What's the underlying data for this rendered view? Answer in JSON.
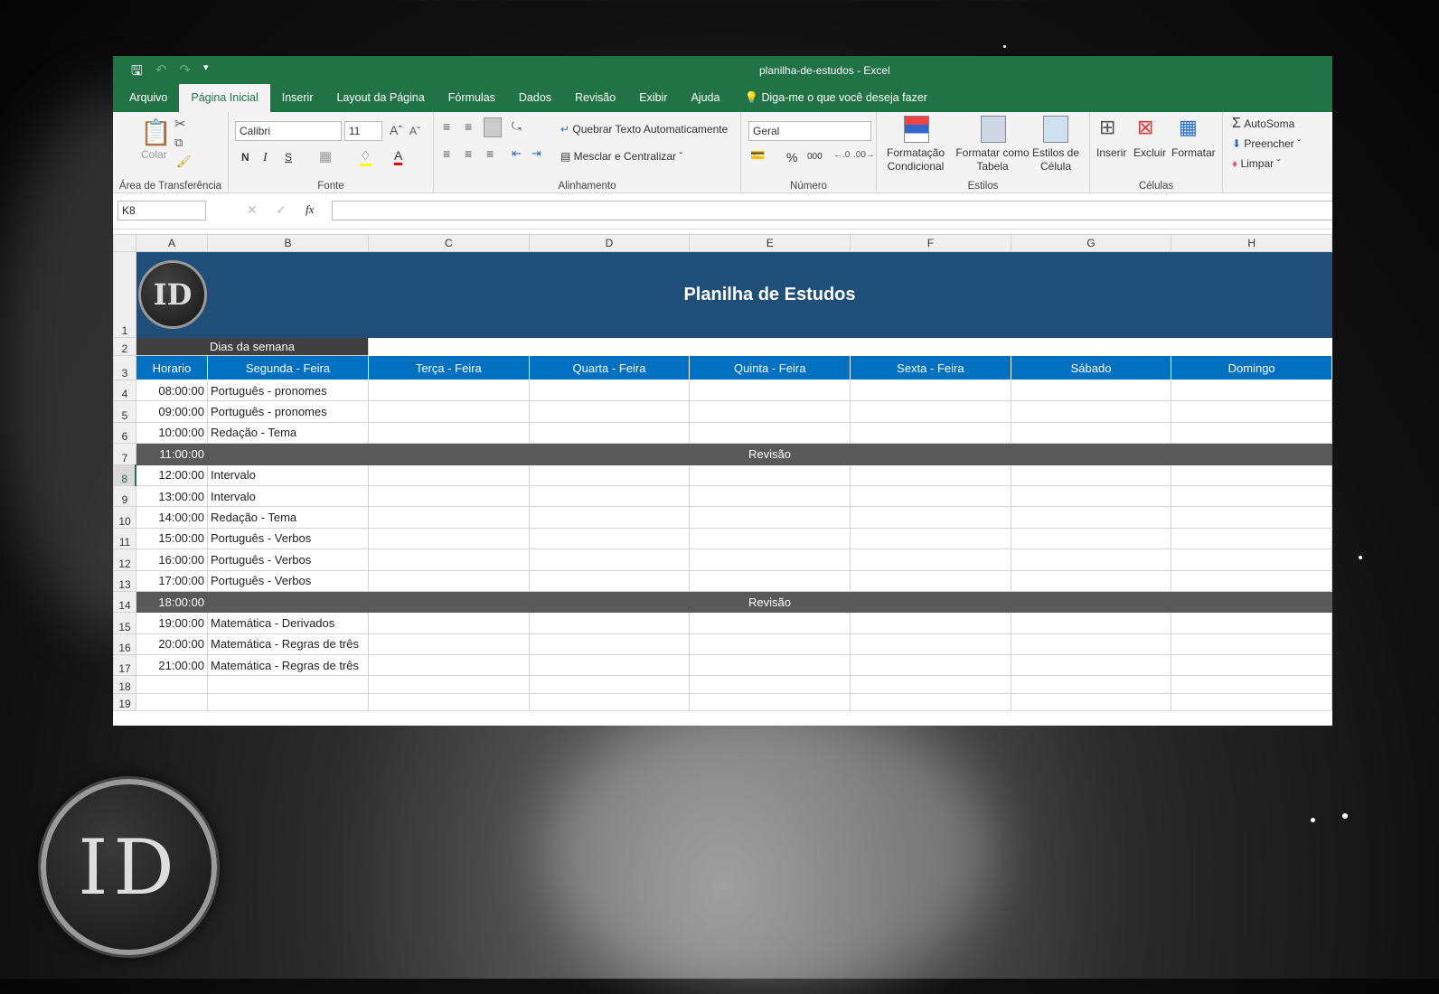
{
  "window": {
    "title": "planilha-de-estudos  -  Excel"
  },
  "tabs": [
    "Arquivo",
    "Página Inicial",
    "Inserir",
    "Layout da Página",
    "Fórmulas",
    "Dados",
    "Revisão",
    "Exibir",
    "Ajuda"
  ],
  "tell_me": "Diga-me o que você deseja fazer",
  "ribbon": {
    "clipboard": {
      "paste": "Colar",
      "label": "Área de Transferência"
    },
    "font": {
      "name": "Calibri",
      "size": "11",
      "bold": "N",
      "italic": "I",
      "underline": "S",
      "label": "Fonte"
    },
    "alignment": {
      "wrap": "Quebrar Texto Automaticamente",
      "merge": "Mesclar e Centralizar",
      "label": "Alinhamento"
    },
    "number": {
      "format": "Geral",
      "percent": "%",
      "thousands": "000",
      "label": "Número"
    },
    "styles": {
      "conditional": "Formatação Condicional",
      "table": "Formatar como Tabela",
      "cell": "Estilos de Célula",
      "label": "Estilos"
    },
    "cells": {
      "insert": "Inserir",
      "delete": "Excluir",
      "format": "Formatar",
      "label": "Células"
    },
    "editing": {
      "autosum": "AutoSoma",
      "fill": "Preencher",
      "clear": "Limpar"
    }
  },
  "formula_bar": {
    "name_box": "K8",
    "fx": "fx",
    "value": ""
  },
  "columns": [
    "A",
    "B",
    "C",
    "D",
    "E",
    "F",
    "G",
    "H"
  ],
  "sheet": {
    "title": "Planilha de Estudos",
    "logo_text": "ID",
    "days_label": "Dias da semana",
    "headers": [
      "Horario",
      "Segunda - Feira",
      "Terça  - Feira",
      "Quarta - Feira",
      "Quinta - Feira",
      "Sexta - Feira",
      "Sábado",
      "Domingo"
    ],
    "rows": [
      {
        "n": "4",
        "time": "08:00:00",
        "b": "Português - pronomes"
      },
      {
        "n": "5",
        "time": "09:00:00",
        "b": "Português - pronomes"
      },
      {
        "n": "6",
        "time": "10:00:00",
        "b": "Redação -  Tema"
      },
      {
        "n": "7",
        "time": "11:00:00",
        "review": "Revisão"
      },
      {
        "n": "8",
        "time": "12:00:00",
        "b": "Intervalo"
      },
      {
        "n": "9",
        "time": "13:00:00",
        "b": "Intervalo"
      },
      {
        "n": "10",
        "time": "14:00:00",
        "b": "Redação -  Tema"
      },
      {
        "n": "11",
        "time": "15:00:00",
        "b": "Português - Verbos"
      },
      {
        "n": "12",
        "time": "16:00:00",
        "b": "Português - Verbos"
      },
      {
        "n": "13",
        "time": "17:00:00",
        "b": "Português - Verbos"
      },
      {
        "n": "14",
        "time": "18:00:00",
        "review": "Revisão"
      },
      {
        "n": "15",
        "time": "19:00:00",
        "b": "Matemática - Derivados"
      },
      {
        "n": "16",
        "time": "20:00:00",
        "b": "Matemática - Regras de três"
      },
      {
        "n": "17",
        "time": "21:00:00",
        "b": "Matemática - Regras de três"
      },
      {
        "n": "18"
      },
      {
        "n": "19"
      }
    ]
  },
  "background_logo": "ID"
}
